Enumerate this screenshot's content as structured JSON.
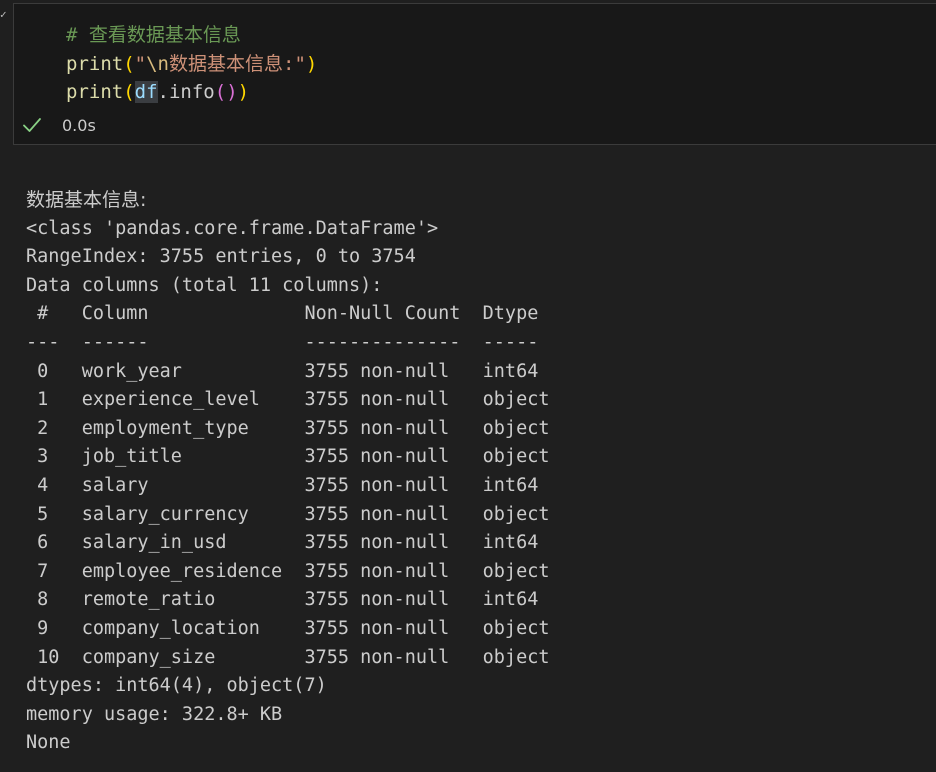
{
  "code": {
    "line1": {
      "comment": "# 查看数据基本信息"
    },
    "line2": {
      "fn": "print",
      "open": "(",
      "quote_open": "\"",
      "escape": "\\n",
      "text": "数据基本信息:",
      "quote_close": "\"",
      "close": ")"
    },
    "line3": {
      "fn": "print",
      "open": "(",
      "var": "df",
      "dot_method": ".info",
      "inner_open": "(",
      "inner_close": ")",
      "close": ")"
    }
  },
  "status": {
    "icon": "check-icon",
    "success_color": "#89d185",
    "time": "0.0s"
  },
  "output": {
    "lines": [
      "数据基本信息:",
      "<class 'pandas.core.frame.DataFrame'>",
      "RangeIndex: 3755 entries, 0 to 3754",
      "Data columns (total 11 columns):",
      " #   Column              Non-Null Count  Dtype ",
      "---  ------              --------------  ----- ",
      " 0   work_year           3755 non-null   int64 ",
      " 1   experience_level    3755 non-null   object",
      " 2   employment_type     3755 non-null   object",
      " 3   job_title           3755 non-null   object",
      " 4   salary              3755 non-null   int64 ",
      " 5   salary_currency     3755 non-null   object",
      " 6   salary_in_usd       3755 non-null   int64 ",
      " 7   employee_residence  3755 non-null   object",
      " 8   remote_ratio        3755 non-null   int64 ",
      " 9   company_location    3755 non-null   object",
      " 10  company_size        3755 non-null   object",
      "dtypes: int64(4), object(7)",
      "memory usage: 322.8+ KB",
      "None"
    ]
  }
}
